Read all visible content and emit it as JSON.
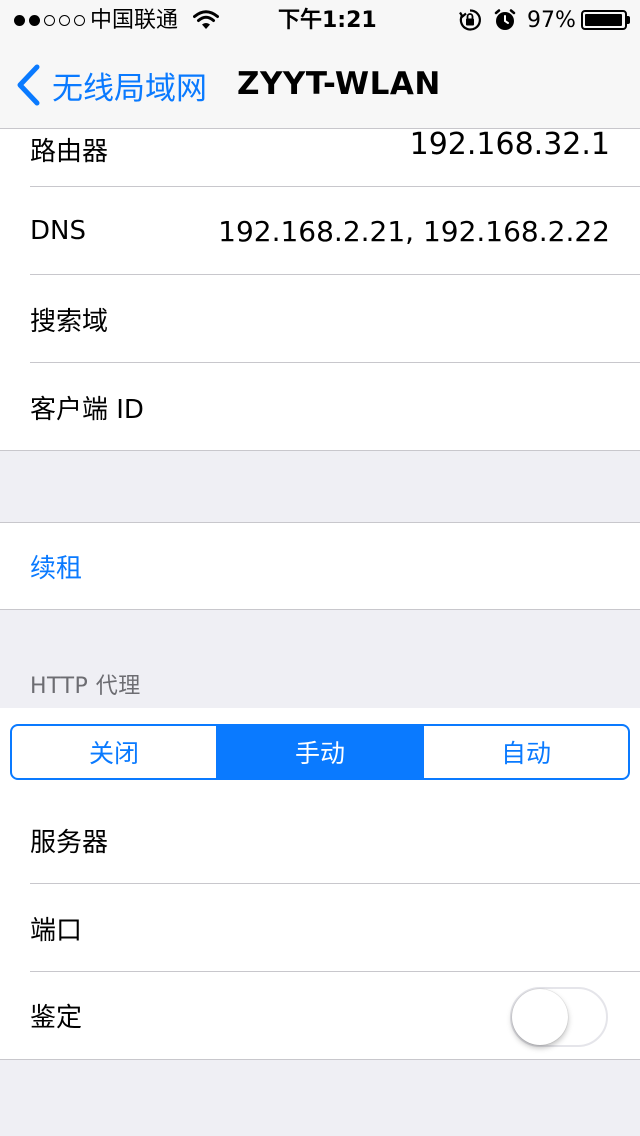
{
  "status_bar": {
    "carrier": "中国联通",
    "time": "下午1:21",
    "battery_percent": "97%",
    "battery_level": 0.97,
    "signal_bars_filled": 2,
    "signal_bars_total": 5
  },
  "nav": {
    "back_label": "无线局域网",
    "title": "ZYYT-WLAN"
  },
  "info_rows": [
    {
      "label": "路由器",
      "value": "192.168.32.1"
    },
    {
      "label": "DNS",
      "value": "192.168.2.21, 192.168.2.22"
    },
    {
      "label": "搜索域",
      "value": ""
    },
    {
      "label": "客户端 ID",
      "value": ""
    }
  ],
  "renew": {
    "label": "续租"
  },
  "http_proxy": {
    "header": "HTTP 代理",
    "segments": [
      "关闭",
      "手动",
      "自动"
    ],
    "selected": "手动",
    "rows": [
      {
        "label": "服务器"
      },
      {
        "label": "端口"
      },
      {
        "label": "鉴定"
      }
    ],
    "auth_enabled": false
  },
  "colors": {
    "accent": "#0a7aff",
    "background": "#efeff4",
    "separator": "#c8c7cc"
  }
}
